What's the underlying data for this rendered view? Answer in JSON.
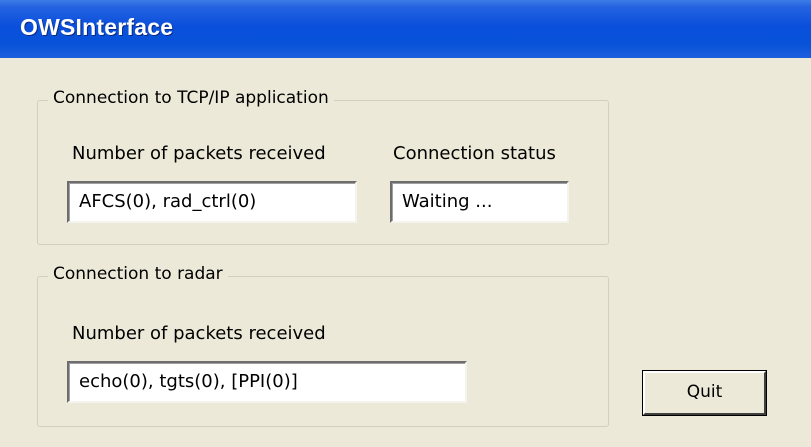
{
  "window": {
    "title": "OWSInterface"
  },
  "tcp_group": {
    "legend": "Connection to TCP/IP application",
    "packets_label": "Number of packets received",
    "packets_value": "AFCS(0), rad_ctrl(0)",
    "status_label": "Connection status",
    "status_value": "Waiting ..."
  },
  "radar_group": {
    "legend": "Connection to radar",
    "packets_label": "Number of packets received",
    "packets_value": "echo(0), tgts(0), [PPI(0)]"
  },
  "buttons": {
    "quit_label": "Quit"
  },
  "colors": {
    "titlebar": "#0752d8",
    "window_bg": "#ece9d8"
  }
}
